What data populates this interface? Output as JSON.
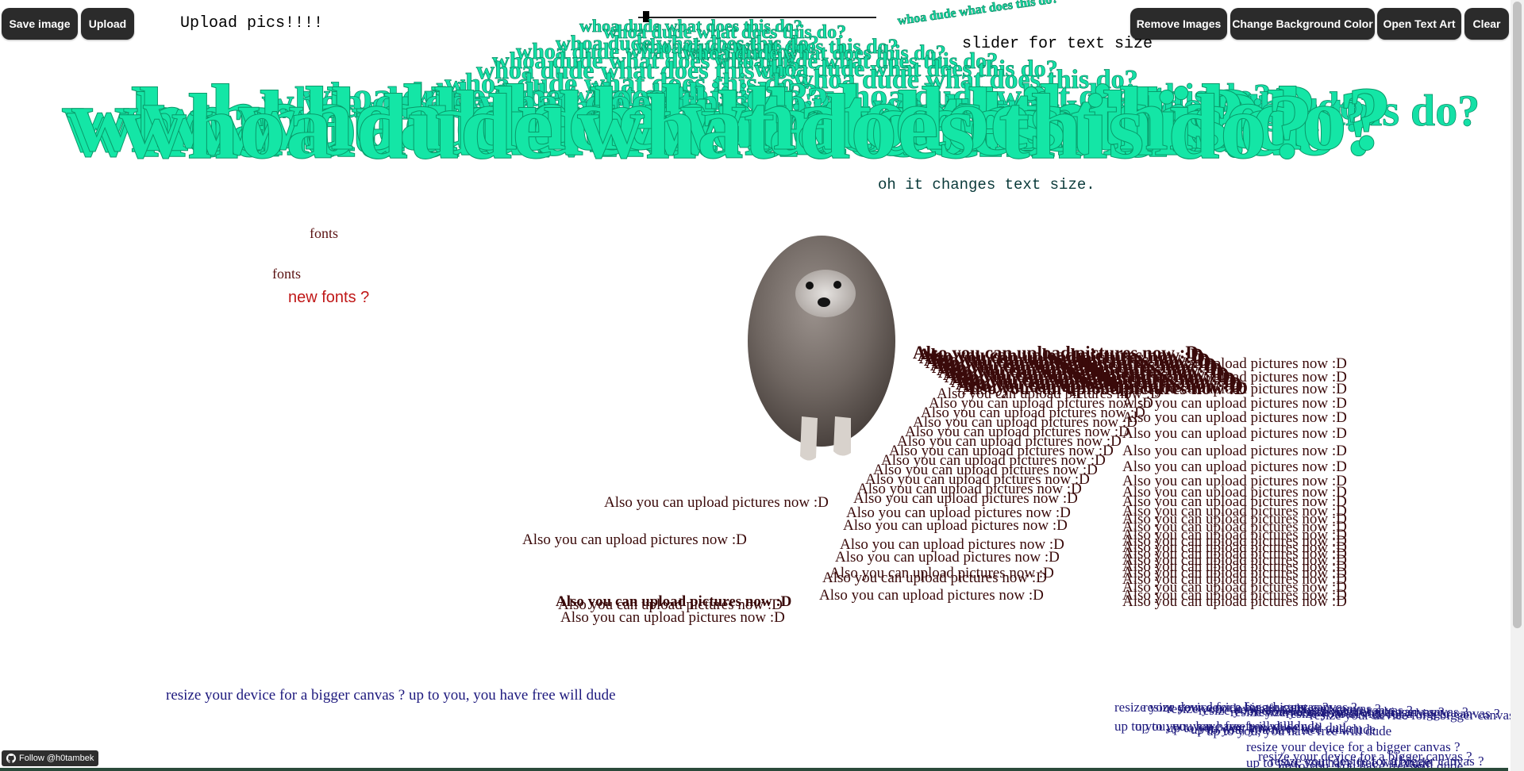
{
  "toolbar_left": {
    "save_label": "Save image",
    "upload_label": "Upload"
  },
  "toolbar_right": {
    "remove_label": "Remove Images",
    "bg_label": "Change Background Color",
    "text_art_label": "Open Text Art",
    "clear_label": "Clear"
  },
  "upload_heading": "Upload pics!!!!",
  "slider": {
    "label": "slider for text size",
    "value_fraction": 0.02
  },
  "art": {
    "headline": "whoa dude what does this do?",
    "teal_color": "#14e6a6",
    "size_note": "oh it changes text size.",
    "font_label": "fonts",
    "new_fonts": "new fonts ?",
    "upload_note": "Also you can upload pictures now :D",
    "resize_note": "resize your device for a bigger canvas ? up to you, you have free will dude",
    "resize_line1": "resize your device for a bigger canvas ?",
    "resize_line2": "up to you, you have free will dude",
    "dark_red": "#3a0a0a",
    "navy": "#1e1a7e"
  },
  "footer": {
    "follow_label": "Follow @h0tambek",
    "icon": "github-icon"
  }
}
